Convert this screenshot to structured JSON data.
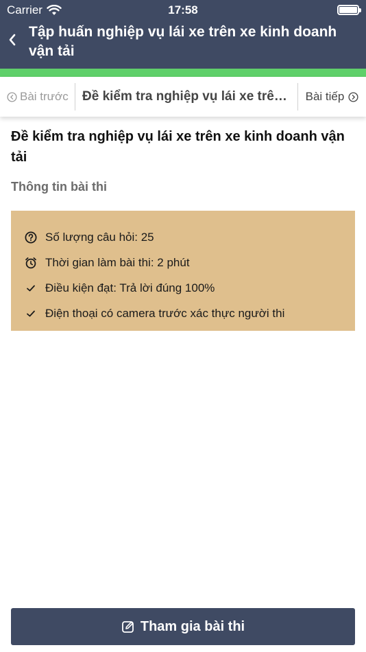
{
  "status_bar": {
    "carrier": "Carrier",
    "time": "17:58"
  },
  "nav": {
    "title": "Tập huấn nghiệp vụ lái xe trên xe kinh doanh vận tải"
  },
  "lesson_nav": {
    "prev_label": "Bài trước",
    "current_title": "Đề kiểm tra nghiệp vụ lái xe trên xe kinh doanh vận tải",
    "next_label": "Bài tiếp"
  },
  "exam": {
    "title": "Đề kiểm tra nghiệp vụ lái xe trên xe kinh doanh vận tải",
    "section_title": "Thông tin bài thi",
    "info": [
      {
        "icon": "question-circle-icon",
        "text": "Số lượng câu hỏi: 25"
      },
      {
        "icon": "alarm-clock-icon",
        "text": "Thời gian làm bài thi: 2 phút"
      },
      {
        "icon": "check-icon",
        "text": "Điều kiện đạt: Trả lời đúng 100%"
      },
      {
        "icon": "check-icon",
        "text": "Điện thoại có camera trước xác thực người thi"
      }
    ]
  },
  "join_button": {
    "label": "Tham gia bài thi",
    "icon": "edit-icon"
  },
  "colors": {
    "header": "#3f4a63",
    "progress": "#5fd06a",
    "info_box": "#dfbf8d",
    "button": "#3f4a63"
  }
}
